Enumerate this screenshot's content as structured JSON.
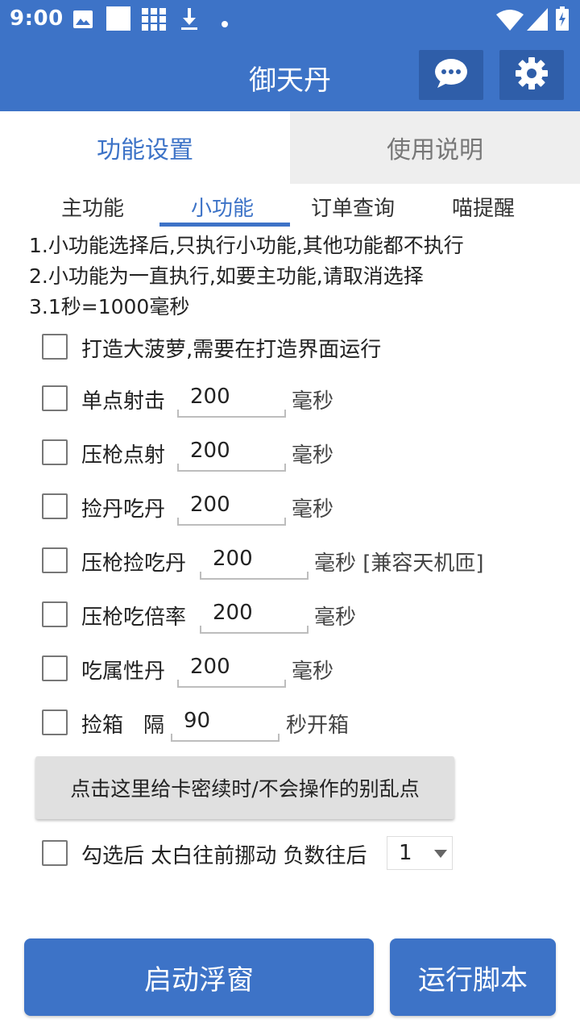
{
  "status_bar": {
    "time": "9:00",
    "icons": [
      "image-icon",
      "square-icon",
      "grid-icon",
      "download-icon",
      "dot-icon",
      "wifi-icon",
      "signal-icon",
      "battery-icon"
    ]
  },
  "app_bar": {
    "title": "御天丹",
    "icons": [
      "chat-icon",
      "gear-icon"
    ]
  },
  "main_tabs": [
    {
      "label": "功能设置",
      "active": true
    },
    {
      "label": "使用说明",
      "active": false
    }
  ],
  "sub_tabs": [
    {
      "label": "主功能",
      "active": false
    },
    {
      "label": "小功能",
      "active": true
    },
    {
      "label": "订单查询",
      "active": false
    },
    {
      "label": "喵提醒",
      "active": false
    }
  ],
  "notes": [
    "1.小功能选择后,只执行小功能,其他功能都不执行",
    "2.小功能为一直执行,如要主功能,请取消选择",
    "3.1秒=1000毫秒"
  ],
  "options": {
    "pineapple": {
      "label": "打造大菠萝,需要在打造界面运行",
      "checked": false
    },
    "single_shot": {
      "label": "单点射击",
      "value": "200",
      "unit": "毫秒",
      "checked": false
    },
    "recoil_shot": {
      "label": "压枪点射",
      "value": "200",
      "unit": "毫秒",
      "checked": false
    },
    "pick_eat": {
      "label": "捡丹吃丹",
      "value": "200",
      "unit": "毫秒",
      "checked": false
    },
    "recoil_pick_eat": {
      "label": "压枪捡吃丹",
      "value": "200",
      "unit": "毫秒 [兼容天机匝]",
      "checked": false
    },
    "recoil_multiplier": {
      "label": "压枪吃倍率",
      "value": "200",
      "unit": "毫秒",
      "checked": false
    },
    "eat_attribute": {
      "label": "吃属性丹",
      "value": "200",
      "unit": "毫秒",
      "checked": false
    },
    "pick_box": {
      "label": "捡箱",
      "label2": "隔",
      "value": "90",
      "unit": "秒开箱",
      "checked": false
    },
    "move": {
      "label": "勾选后 太白往前挪动 负数往后",
      "select_value": "1",
      "checked": false
    }
  },
  "renew_button": "点击这里给卡密续时/不会操作的别乱点",
  "bottom_buttons": {
    "float_window": "启动浮窗",
    "run_script": "运行脚本"
  },
  "colors": {
    "primary": "#3d73c7",
    "primary_dark": "#2f5ea9",
    "inactive_tab_bg": "#eeeeee"
  }
}
